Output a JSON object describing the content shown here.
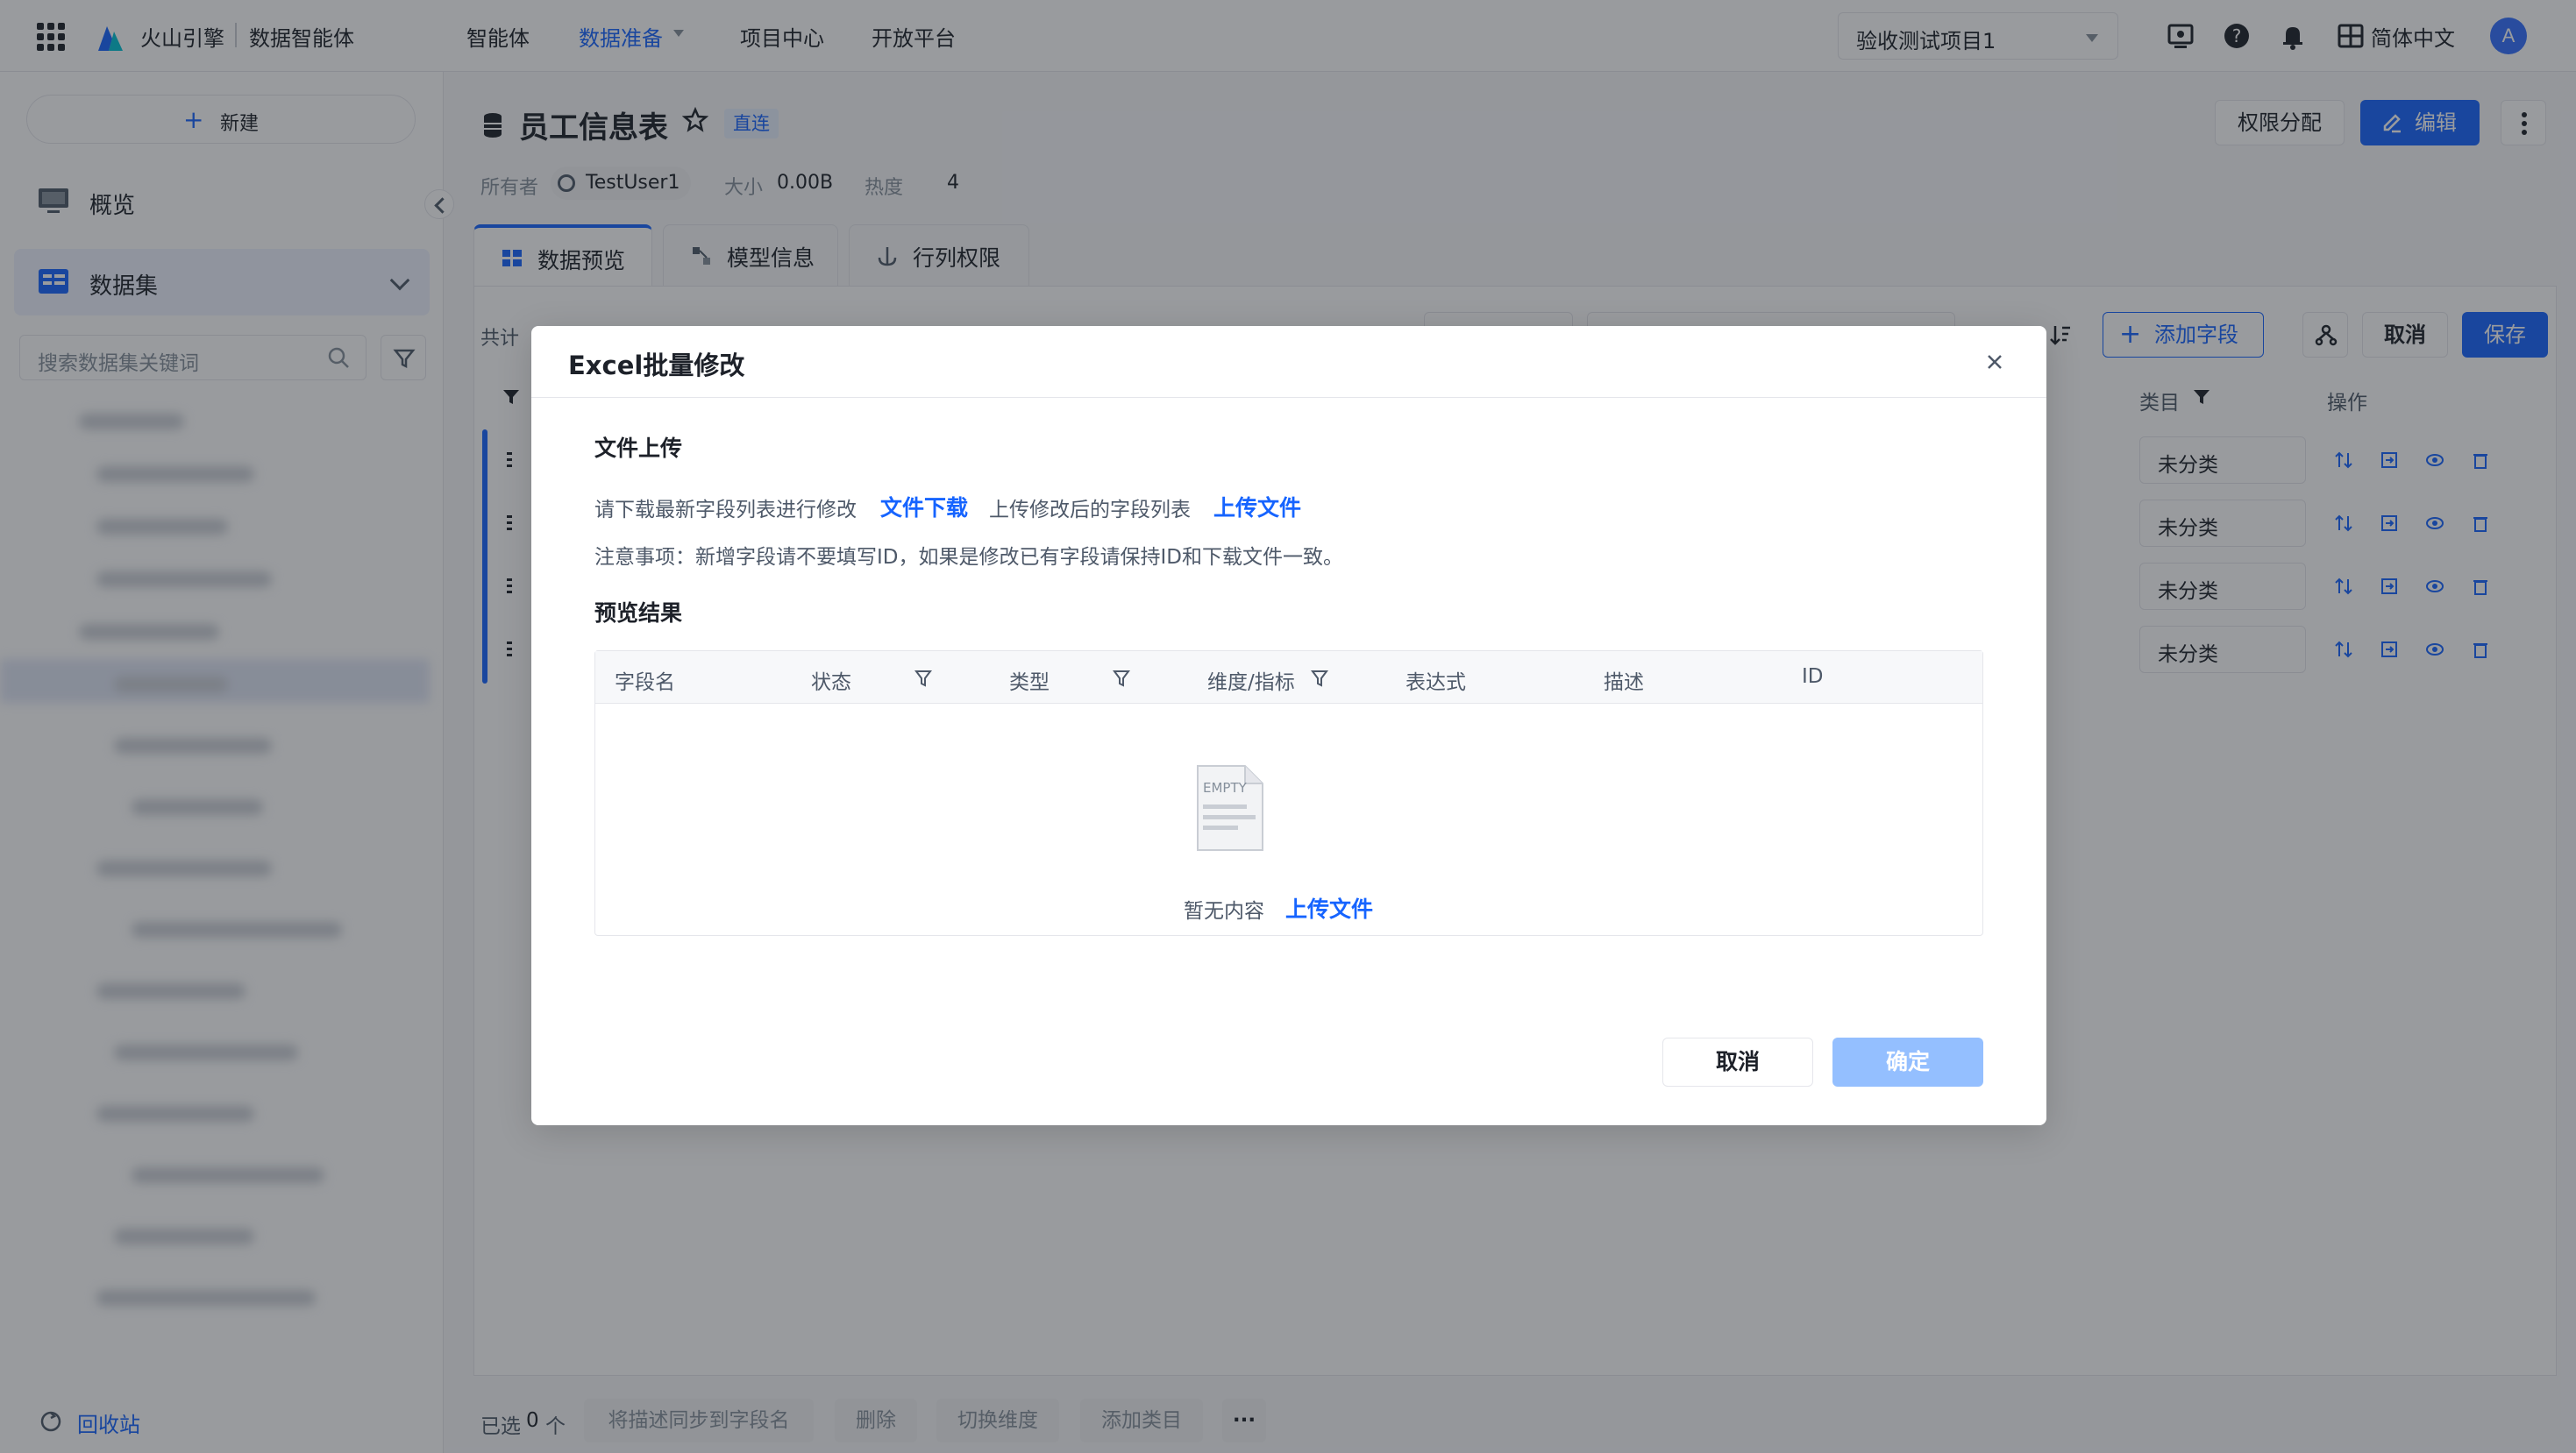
{
  "topnav": {
    "brand": "火山引擎",
    "product": "数据智能体",
    "items": [
      {
        "label": "智能体"
      },
      {
        "label": "数据准备"
      },
      {
        "label": "项目中心"
      },
      {
        "label": "开放平台"
      }
    ],
    "project_select": "验收测试项目1",
    "language": "简体中文",
    "avatar_initial": "A",
    "icons": [
      "grid-icon",
      "help-icon",
      "bell-icon",
      "monitor-icon",
      "translate-icon"
    ]
  },
  "sidebar": {
    "new_button": "新建",
    "items": [
      {
        "label": "概览"
      },
      {
        "label": "数据集"
      }
    ],
    "search_placeholder": "搜索数据集关键词",
    "recycle": "回收站"
  },
  "page": {
    "title": "员工信息表",
    "tag": "直连",
    "owner_label": "所有者",
    "owner": "TestUser1",
    "size_label": "大小",
    "size": "0.00B",
    "heat_label": "热度",
    "heat": "4",
    "perm_button": "权限分配",
    "edit_button": "编辑",
    "tabs": [
      {
        "label": "数据预览"
      },
      {
        "label": "模型信息"
      },
      {
        "label": "行列权限"
      }
    ],
    "count_prefix": "共计",
    "add_field": "添加字段",
    "cancel": "取消",
    "save": "保存",
    "columns": {
      "category": "类目",
      "ops": "操作"
    },
    "rows": [
      {
        "category": "未分类"
      },
      {
        "category": "未分类"
      },
      {
        "category": "未分类"
      },
      {
        "category": "未分类"
      }
    ],
    "bottom": {
      "selected_prefix": "已选",
      "selected_count": "0",
      "selected_suffix": "个",
      "actions": [
        "将描述同步到字段名",
        "删除",
        "切换维度",
        "添加类目"
      ]
    }
  },
  "modal": {
    "title": "Excel批量修改",
    "upload_section": "文件上传",
    "download_hint": "请下载最新字段列表进行修改",
    "download_link": "文件下载",
    "upload_hint": "上传修改后的字段列表",
    "upload_link": "上传文件",
    "notice": "注意事项：新增字段请不要填写ID，如果是修改已有字段请保持ID和下载文件一致。",
    "preview_section": "预览结果",
    "table_headers": [
      {
        "label": "字段名",
        "filter": false
      },
      {
        "label": "状态",
        "filter": true
      },
      {
        "label": "类型",
        "filter": true
      },
      {
        "label": "维度/指标",
        "filter": true
      },
      {
        "label": "表达式",
        "filter": false
      },
      {
        "label": "描述",
        "filter": false
      },
      {
        "label": "ID",
        "filter": false
      }
    ],
    "empty_text": "暂无内容",
    "empty_link": "上传文件",
    "empty_icon_label": "EMPTY",
    "cancel": "取消",
    "confirm": "确定"
  },
  "colors": {
    "primary": "#1664ff",
    "confirm_disabled": "#94bfff",
    "overlay": "rgba(29,33,41,0.45)"
  }
}
